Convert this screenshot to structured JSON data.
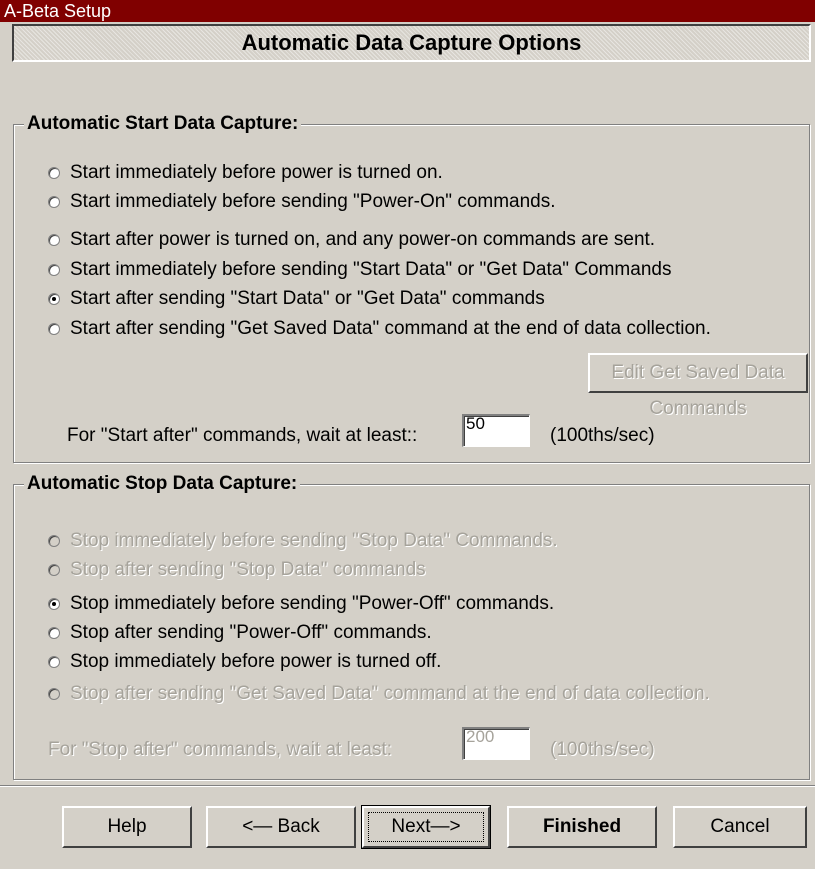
{
  "window": {
    "title": "A-Beta Setup"
  },
  "header": {
    "title": "Automatic Data Capture Options"
  },
  "start_group": {
    "legend": "Automatic Start Data Capture:",
    "options": [
      "Start immediately before power is turned on.",
      "Start immediately before sending \"Power-On\" commands.",
      "Start after power is turned on, and any power-on commands are sent.",
      "Start immediately before sending \"Start Data\" or \"Get Data\" Commands",
      "Start after sending \"Start Data\" or \"Get Data\" commands",
      "Start after sending \"Get Saved Data\" command at the end of data collection."
    ],
    "selected_index": 4,
    "edit_button": "Edit Get Saved Data Commands",
    "wait_label": "For \"Start after\" commands, wait at least::",
    "wait_value": "50",
    "wait_unit": "(100ths/sec)"
  },
  "stop_group": {
    "legend": "Automatic Stop Data Capture:",
    "options": [
      "Stop immediately before sending \"Stop Data\" Commands.",
      "Stop after sending \"Stop Data\" commands",
      "Stop immediately before sending \"Power-Off\" commands.",
      "Stop after sending \"Power-Off\" commands.",
      "Stop immediately before power is turned off.",
      "Stop after sending \"Get Saved Data\" command at the end of data collection."
    ],
    "selected_index": 2,
    "disabled_indices": [
      0,
      1,
      5
    ],
    "wait_label": "For \"Stop after\" commands, wait at least:",
    "wait_value": "200",
    "wait_unit": "(100ths/sec)"
  },
  "buttons": {
    "help": "Help",
    "back": "<— Back",
    "next": "Next—>",
    "finished": "Finished",
    "cancel": "Cancel"
  },
  "colors": {
    "titlebar": "#800000",
    "face": "#d4d0c8",
    "disabled_text": "#a6a39b"
  }
}
